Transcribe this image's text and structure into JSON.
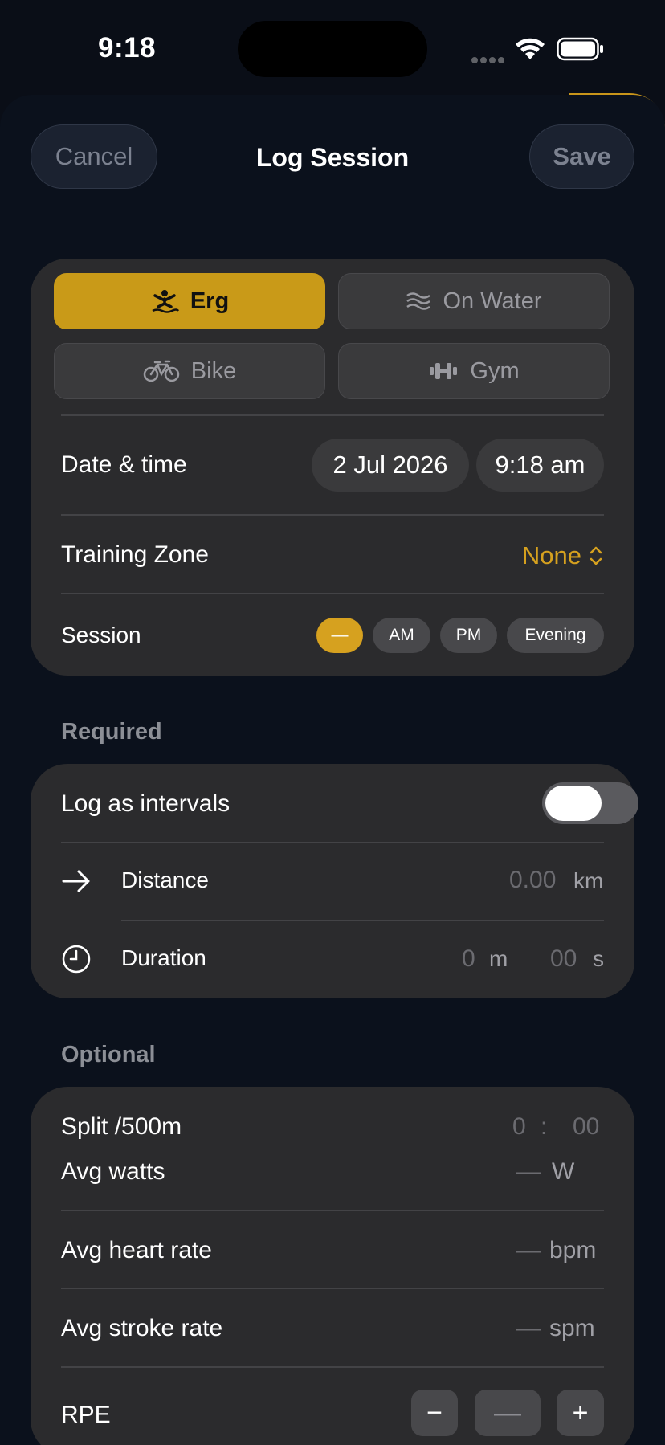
{
  "status_bar": {
    "time": "9:18"
  },
  "nav": {
    "cancel_label": "Cancel",
    "title": "Log Session",
    "save_label": "Save"
  },
  "activity_types": [
    {
      "label": "Erg",
      "icon": "rower-icon",
      "selected": true
    },
    {
      "label": "On Water",
      "icon": "waves-icon",
      "selected": false
    },
    {
      "label": "Bike",
      "icon": "bicycle-icon",
      "selected": false
    },
    {
      "label": "Gym",
      "icon": "dumbbell-icon",
      "selected": false
    }
  ],
  "date_time": {
    "label": "Date & time",
    "date": "2 Jul 2026",
    "time": "9:18 am"
  },
  "training_zone": {
    "label": "Training Zone",
    "value": "None"
  },
  "session": {
    "label": "Session",
    "options": [
      "—",
      "AM",
      "PM",
      "Evening"
    ],
    "selected": "—"
  },
  "required": {
    "title": "Required",
    "intervals_label": "Log as intervals",
    "intervals_on": false,
    "distance": {
      "label": "Distance",
      "placeholder": "0.00",
      "unit": "km"
    },
    "duration": {
      "label": "Duration",
      "min_placeholder": "0",
      "min_unit": "m",
      "sec_placeholder": "00",
      "sec_unit": "s"
    }
  },
  "optional": {
    "title": "Optional",
    "split": {
      "label": "Split /500m",
      "min_placeholder": "0",
      "separator": ":",
      "sec_placeholder": "00"
    },
    "watts": {
      "label": "Avg watts",
      "placeholder": "—",
      "unit": "W"
    },
    "heart_rate": {
      "label": "Avg heart rate",
      "placeholder": "—",
      "unit": "bpm"
    },
    "stroke_rate": {
      "label": "Avg stroke rate",
      "placeholder": "—",
      "unit": "spm"
    },
    "rpe": {
      "label": "RPE",
      "minus": "−",
      "value": "—",
      "plus": "+"
    }
  },
  "colors": {
    "accent": "#d6a11f",
    "card": "#2b2b2d",
    "background": "#0b111c"
  }
}
